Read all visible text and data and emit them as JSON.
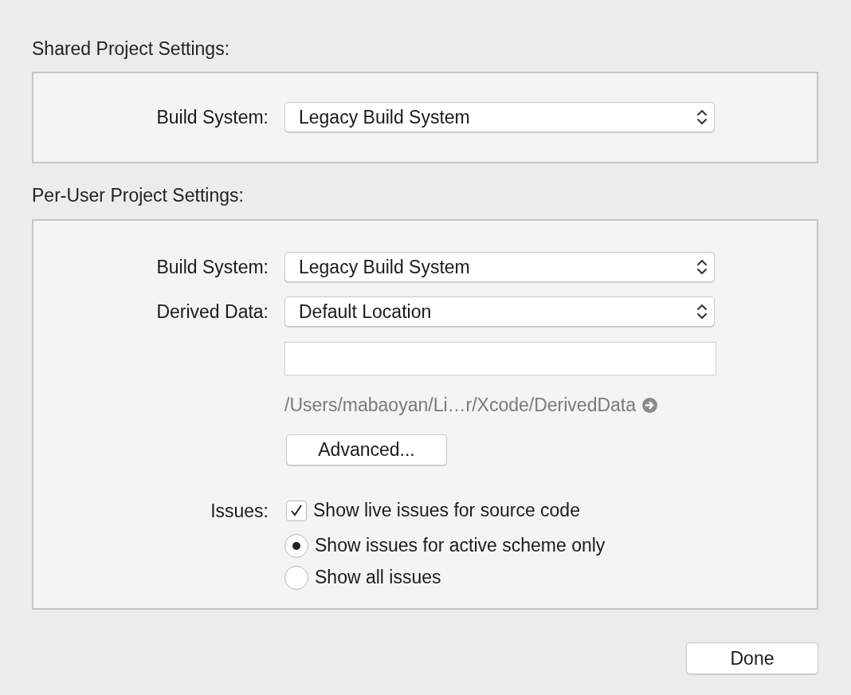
{
  "shared": {
    "heading": "Shared Project Settings:",
    "popups": [
      {
        "label": "Build System:",
        "value": "Legacy Build System"
      }
    ]
  },
  "per_user": {
    "heading": "Per-User Project Settings:",
    "popups": [
      {
        "label": "Build System:",
        "value": "Legacy Build System"
      },
      {
        "label": "Derived Data:",
        "value": "Default Location"
      }
    ],
    "path": "/Users/mabaoyan/Li…r/Xcode/DerivedData",
    "advanced_button": "Advanced...",
    "issues_label": "Issues:",
    "options": [
      {
        "kind": "checkbox",
        "label": "Show live issues for source code",
        "checked": true
      },
      {
        "kind": "radio",
        "label": "Show issues for active scheme only",
        "selected": true
      },
      {
        "kind": "radio",
        "label": "Show all issues",
        "selected": false
      }
    ]
  },
  "done_button": "Done"
}
